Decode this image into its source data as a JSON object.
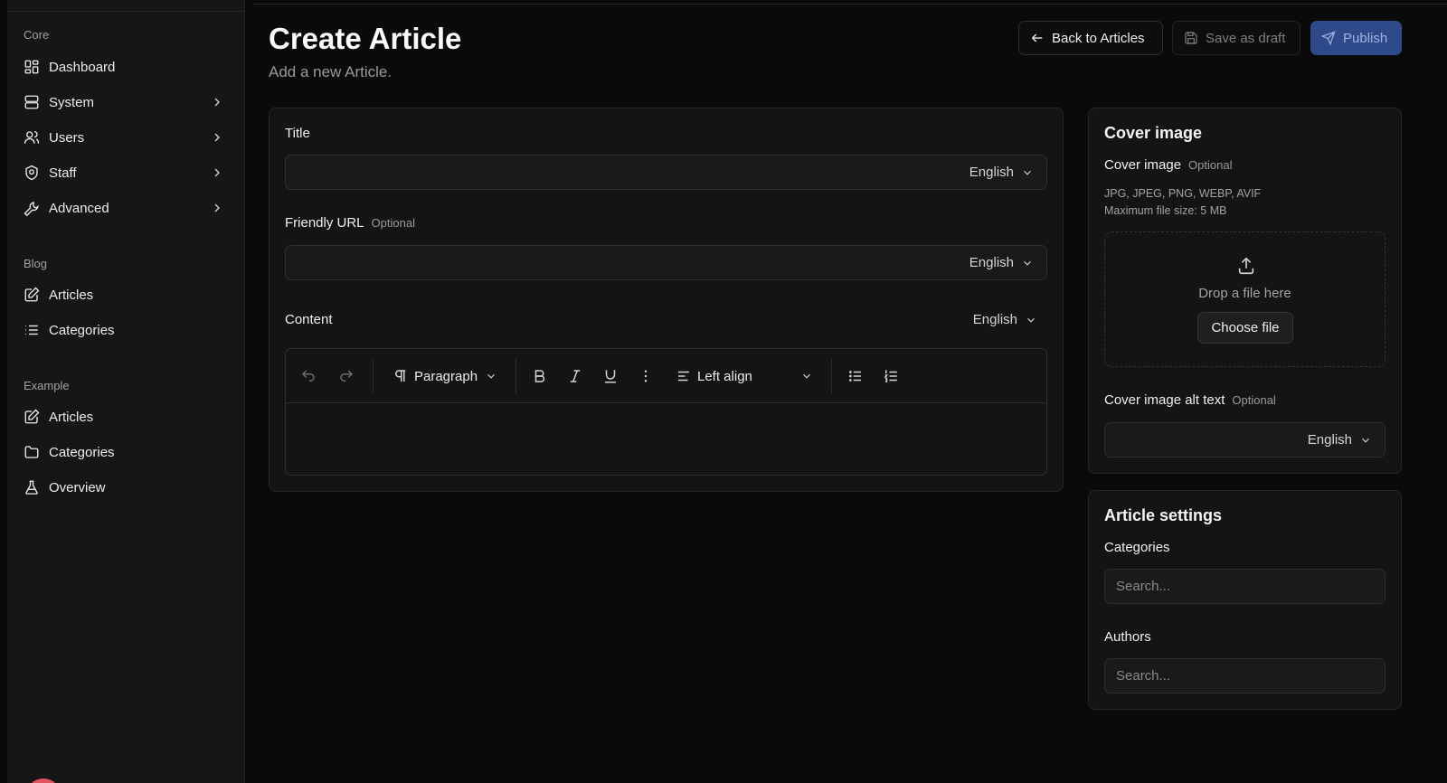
{
  "sidebar": {
    "groups": [
      {
        "label": "Core"
      },
      {
        "label": "Blog"
      },
      {
        "label": "Example"
      }
    ],
    "items": [
      {
        "label": "Dashboard",
        "icon": "grid-icon"
      },
      {
        "label": "System",
        "icon": "server-icon"
      },
      {
        "label": "Users",
        "icon": "users-icon"
      },
      {
        "label": "Staff",
        "icon": "shield-icon"
      },
      {
        "label": "Advanced",
        "icon": "wrench-icon"
      },
      {
        "label": "Articles",
        "icon": "edit-icon"
      },
      {
        "label": "Categories",
        "icon": "list-icon"
      },
      {
        "label": "Articles",
        "icon": "edit-icon"
      },
      {
        "label": "Categories",
        "icon": "folder-icon"
      },
      {
        "label": "Overview",
        "icon": "flask-icon"
      }
    ]
  },
  "header": {
    "title": "Create Article",
    "subtitle": "Add a new Article.",
    "back_label": "Back to Articles",
    "draft_label": "Save as draft",
    "publish_label": "Publish"
  },
  "form": {
    "title_label": "Title",
    "friendly_url_label": "Friendly URL",
    "optional_label": "Optional",
    "content_label": "Content",
    "language": "English",
    "toolbar": {
      "block_type": "Paragraph",
      "align": "Left align"
    }
  },
  "cover": {
    "heading": "Cover image",
    "field_label": "Cover image",
    "formats": "JPG, JPEG, PNG, WEBP, AVIF",
    "max_size": "Maximum file size: 5 MB",
    "drop_text": "Drop a file here",
    "choose_label": "Choose file",
    "alt_label": "Cover image alt text"
  },
  "settings": {
    "heading": "Article settings",
    "categories_label": "Categories",
    "authors_label": "Authors",
    "search_placeholder": "Search..."
  },
  "colors": {
    "background": "#0a0a0a",
    "sidebar": "#161616",
    "card": "#141414",
    "publish": "#2f4a8a"
  }
}
